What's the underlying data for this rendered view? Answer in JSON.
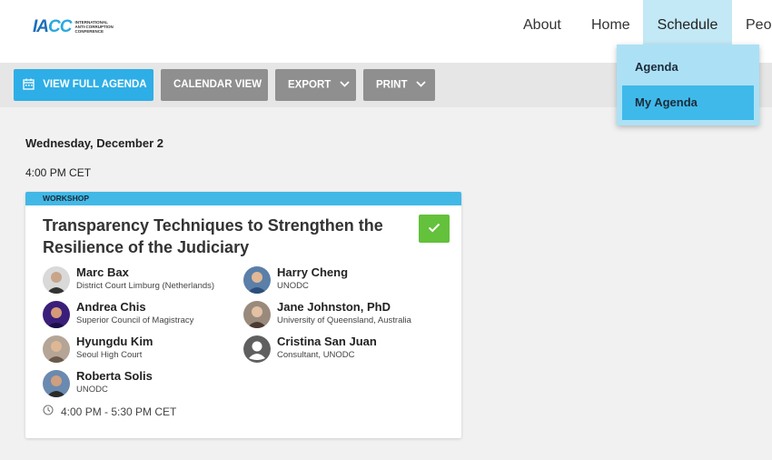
{
  "logo": {
    "mark": "IACC",
    "line1": "International",
    "line2": "Anti-Corruption",
    "line3": "Conference"
  },
  "nav": {
    "about": "About",
    "home": "Home",
    "schedule": "Schedule",
    "people": "Peop"
  },
  "dropdown": {
    "agenda": "Agenda",
    "my_agenda": "My Agenda"
  },
  "toolbar": {
    "view_full_agenda": "VIEW FULL AGENDA",
    "calendar_view": "CALENDAR VIEW",
    "export": "EXPORT",
    "print": "PRINT"
  },
  "schedule": {
    "day": "Wednesday, December 2",
    "time": "4:00 PM CET",
    "session": {
      "tag": "WORKSHOP",
      "title": "Transparency Techniques to Strengthen the Resilience of the Judiciary",
      "time_range": "4:00 PM - 5:30 PM CET",
      "speakers": [
        {
          "name": "Marc Bax",
          "org": "District Court Limburg (Netherlands)"
        },
        {
          "name": "Harry Cheng",
          "org": "UNODC"
        },
        {
          "name": "Andrea Chis",
          "org": "Superior Council of Magistracy"
        },
        {
          "name": "Jane Johnston, PhD",
          "org": "University of Queensland, Australia"
        },
        {
          "name": "Hyungdu Kim",
          "org": "Seoul High Court"
        },
        {
          "name": "Cristina San Juan",
          "org": "Consultant, UNODC"
        },
        {
          "name": "Roberta Solis",
          "org": "UNODC"
        }
      ]
    }
  },
  "colors": {
    "accent": "#2eaee6",
    "nav_active": "#c3e8f6",
    "dropdown_bg": "#ace1f5",
    "dropdown_active": "#3fb9e9",
    "check": "#63c13b",
    "button_grey": "#8f8f8f"
  }
}
